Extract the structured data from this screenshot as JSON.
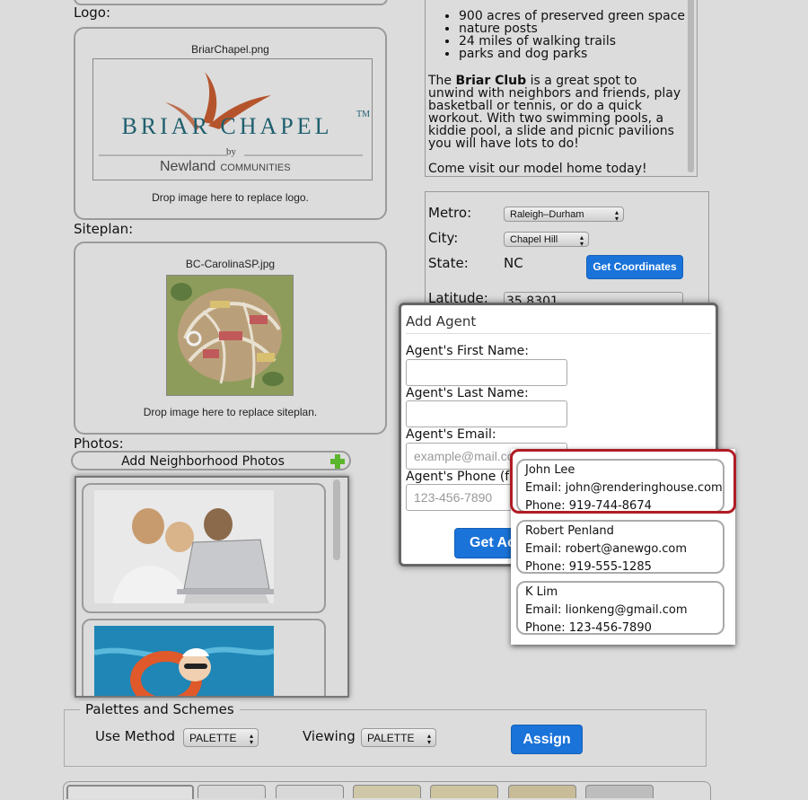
{
  "logo": {
    "label": "Logo:",
    "filename": "BriarChapel.png",
    "brand_top": "BRIAR CHAPEL",
    "tm": "TM",
    "by": "by",
    "brand_bottom_a": "Newland",
    "brand_bottom_b": "COMMUNITIES",
    "drop_text": "Drop image here to replace logo."
  },
  "siteplan": {
    "label": "Siteplan:",
    "filename": "BC-CarolinaSP.jpg",
    "drop_text": "Drop image here to replace siteplan."
  },
  "photos": {
    "label": "Photos:",
    "add_button": "Add Neighborhood Photos"
  },
  "description": {
    "bullets": [
      "900 acres of preserved green space",
      "nature posts",
      "24 miles of walking trails",
      "parks and dog parks"
    ],
    "para1_pre": "The ",
    "para1_bold": "Briar Club",
    "para1_post": " is a great spot to unwind with neighbors and friends, play basketball or tennis, or do a quick workout. With two swimming pools, a kiddie pool, a slide and picnic pavilions you will have lots to do!",
    "para2": "Come visit our model home today!"
  },
  "location": {
    "metro_label": "Metro:",
    "metro_value": "Raleigh–Durham",
    "city_label": "City:",
    "city_value": "Chapel Hill",
    "state_label": "State:",
    "state_value": "NC",
    "coords_button": "Get Coordinates",
    "latitude_label": "Latitude:",
    "latitude_value": "35.8301"
  },
  "modal": {
    "title": "Add Agent",
    "first_label": "Agent's First Name:",
    "last_label": "Agent's Last Name:",
    "email_label": "Agent's Email:",
    "email_placeholder": "example@mail.com",
    "phone_label": "Agent's Phone (for",
    "phone_placeholder": "123-456-7890",
    "submit_label": "Get Ac"
  },
  "agents": [
    {
      "name": "John Lee",
      "email": "Email: john@renderinghouse.com",
      "phone": "Phone: 919-744-8674"
    },
    {
      "name": "Robert Penland",
      "email": "Email: robert@anewgo.com",
      "phone": "Phone: 919-555-1285"
    },
    {
      "name": "K Lim",
      "email": "Email: lionkeng@gmail.com",
      "phone": "Phone: 123-456-7890"
    }
  ],
  "palettes": {
    "legend": "Palettes and Schemes",
    "use_method_label": "Use Method",
    "use_method_value": "PALETTE",
    "viewing_label": "Viewing",
    "viewing_value": "PALETTE",
    "assign_button": "Assign"
  },
  "colors": {
    "accent_blue": "#1a73d9",
    "highlight_red": "#b01c24",
    "brand_teal": "#1f5f6e",
    "brand_rust": "#b5542c",
    "plus_green": "#5bb52d"
  }
}
